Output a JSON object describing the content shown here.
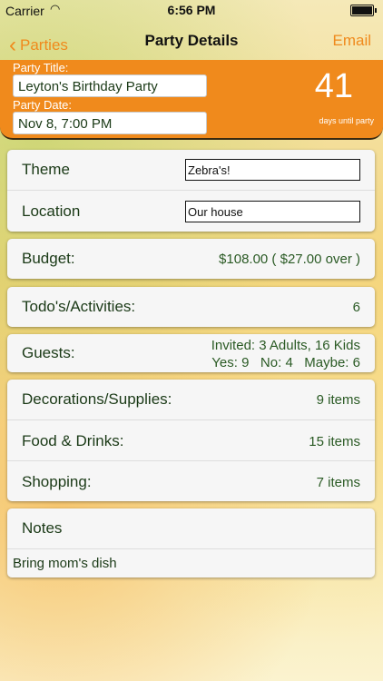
{
  "status": {
    "carrier": "Carrier",
    "time": "6:56 PM"
  },
  "nav": {
    "back_label": "Parties",
    "title": "Party Details",
    "action_label": "Email"
  },
  "header": {
    "title_label": "Party Title:",
    "title_value": "Leyton's Birthday Party",
    "date_label": "Party Date:",
    "date_value": "Nov 8, 7:00 PM",
    "days_number": "41",
    "days_label": "days until party"
  },
  "details": {
    "theme_label": "Theme",
    "theme_value": "Zebra's!",
    "location_label": "Location",
    "location_value": "Our house"
  },
  "budget": {
    "label": "Budget:",
    "value": "$108.00 ( $27.00 over )"
  },
  "todos": {
    "label": "Todo's/Activities:",
    "value": "6"
  },
  "guests": {
    "label": "Guests:",
    "invited": "Invited: 3 Adults, 16 Kids",
    "rsvp": "Yes: 9   No: 4   Maybe: 6"
  },
  "lists": [
    {
      "label": "Decorations/Supplies:",
      "value": "9 items"
    },
    {
      "label": "Food & Drinks:",
      "value": "15 items"
    },
    {
      "label": "Shopping:",
      "value": "7 items"
    }
  ],
  "notes": {
    "label": "Notes",
    "text": "Bring mom's dish"
  }
}
